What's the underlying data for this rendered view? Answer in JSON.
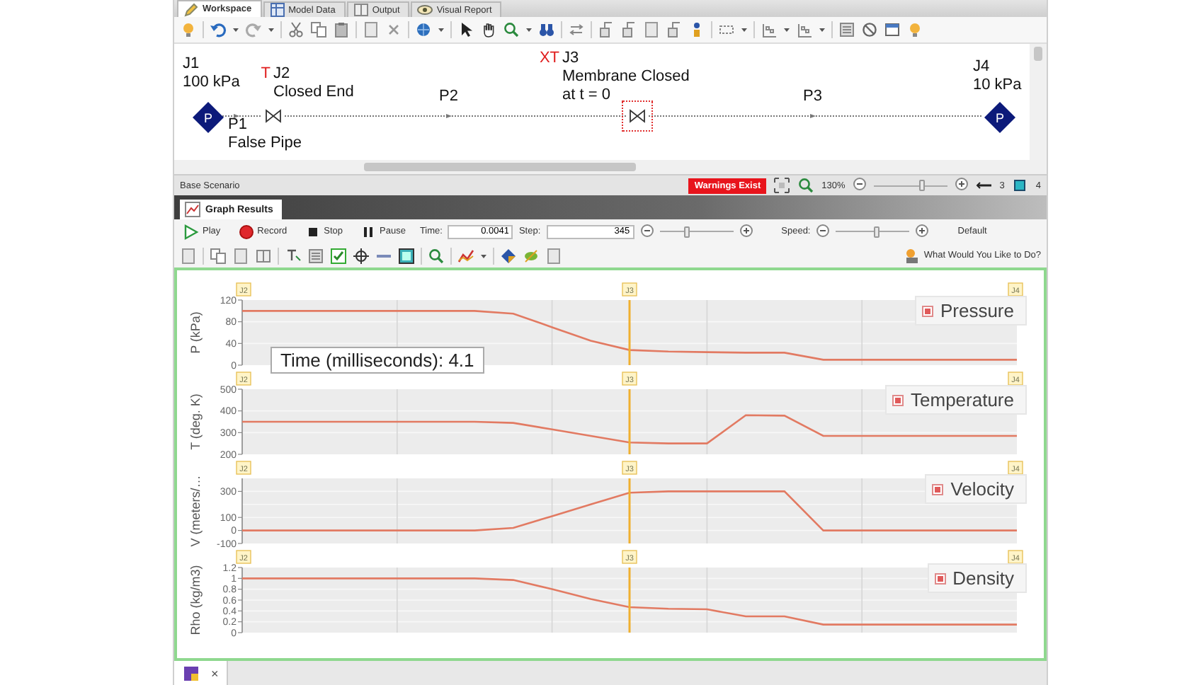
{
  "tabs": [
    {
      "label": "Workspace",
      "kind": "workspace",
      "selected": true
    },
    {
      "label": "Model Data",
      "kind": "data",
      "selected": false
    },
    {
      "label": "Output",
      "kind": "output",
      "selected": false
    },
    {
      "label": "Visual Report",
      "kind": "report",
      "selected": false
    }
  ],
  "diagram": {
    "junctions": [
      {
        "kind": "pump",
        "name": "J1",
        "symbol": "P",
        "lines": [
          "100 kPa"
        ],
        "selected": false
      },
      {
        "kind": "valve",
        "name": "J2",
        "flags": "T",
        "lines": [
          "Closed End"
        ],
        "selected": false
      },
      {
        "kind": "valve",
        "name": "J3",
        "flags": "XT",
        "lines": [
          "Membrane Closed",
          "at t = 0"
        ],
        "selected": true
      },
      {
        "kind": "pump",
        "name": "J4",
        "symbol": "P",
        "lines": [
          "10 kPa"
        ],
        "selected": false
      }
    ],
    "pipes": [
      {
        "name": "P1",
        "lines": [
          "False Pipe"
        ]
      },
      {
        "name": "P2"
      },
      {
        "name": "P3"
      }
    ]
  },
  "status_bar": {
    "scenario": "Base Scenario",
    "warning": "Warnings Exist",
    "zoom": "130%",
    "zoom_slider": {
      "level": 0.65
    },
    "counts": [
      {
        "kind": "pipes",
        "value": "3"
      },
      {
        "kind": "junctions",
        "value": "4"
      }
    ]
  },
  "graph_tab": {
    "label": "Graph Results"
  },
  "playback": {
    "buttons": [
      {
        "kind": "play",
        "label": "Play"
      },
      {
        "kind": "record",
        "label": "Record"
      },
      {
        "kind": "stop",
        "label": "Stop"
      },
      {
        "kind": "pause",
        "label": "Pause"
      }
    ],
    "time": {
      "label": "Time:",
      "value": "0.0041"
    },
    "step": {
      "label": "Step:",
      "value": "345",
      "level": 0.38
    },
    "speed": {
      "label": "Speed:",
      "level": 0.55,
      "preset": "Default"
    }
  },
  "help_link": "What Would You Like to Do?",
  "graph": {
    "tooltip": "Time (milliseconds): 4.1",
    "cursor": {
      "visible": true
    },
    "panels": [
      {
        "checked": true,
        "chart_data": {
          "type": "line",
          "grid": true,
          "ylabel": "P (kPa)",
          "ylim": [
            0,
            120
          ],
          "yticks": [
            0,
            40,
            80,
            120
          ],
          "series": [
            {
              "name": "Pressure",
              "color": "#e27a62",
              "values": [
                100,
                100,
                100,
                100,
                100,
                100,
                100,
                95,
                70,
                45,
                28,
                25,
                24,
                23,
                23,
                10,
                10,
                10,
                10,
                10,
                10
              ]
            }
          ],
          "annotations": [
            "J2",
            "J3",
            "J4"
          ]
        }
      },
      {
        "checked": true,
        "chart_data": {
          "type": "line",
          "grid": true,
          "ylabel": "T (deg. K)",
          "ylim": [
            200,
            500
          ],
          "yticks": [
            200,
            300,
            400,
            500
          ],
          "series": [
            {
              "name": "Temperature",
              "color": "#e27a62",
              "values": [
                350,
                350,
                350,
                350,
                350,
                350,
                350,
                345,
                315,
                285,
                255,
                250,
                250,
                380,
                378,
                285,
                285,
                285,
                285,
                285,
                285
              ]
            }
          ],
          "annotations": [
            "J2",
            "J3",
            "J4"
          ]
        }
      },
      {
        "checked": true,
        "chart_data": {
          "type": "line",
          "grid": true,
          "ylabel": "V (meters/…",
          "ylim": [
            -100,
            400
          ],
          "yticks": [
            -100,
            0,
            100,
            300
          ],
          "series": [
            {
              "name": "Velocity",
              "color": "#e27a62",
              "values": [
                0,
                0,
                0,
                0,
                0,
                0,
                0,
                20,
                110,
                200,
                290,
                300,
                300,
                300,
                300,
                0,
                0,
                0,
                0,
                0,
                0
              ]
            }
          ],
          "annotations": [
            "J2",
            "J3",
            "J4"
          ]
        }
      },
      {
        "checked": true,
        "chart_data": {
          "type": "line",
          "grid": true,
          "ylabel": "Rho (kg/m3)",
          "ylim": [
            0,
            1.2
          ],
          "yticks": [
            0,
            0.2,
            0.4,
            0.6,
            0.8,
            1,
            1.2
          ],
          "series": [
            {
              "name": "Density",
              "color": "#e27a62",
              "values": [
                1,
                1,
                1,
                1,
                1,
                1,
                1,
                0.97,
                0.8,
                0.62,
                0.47,
                0.44,
                0.43,
                0.3,
                0.3,
                0.15,
                0.15,
                0.15,
                0.15,
                0.15,
                0.15
              ]
            }
          ],
          "annotations": [
            "J2",
            "J3",
            "J4"
          ]
        }
      }
    ]
  },
  "document_tabs": [
    {
      "close": "×",
      "selected": true
    }
  ]
}
